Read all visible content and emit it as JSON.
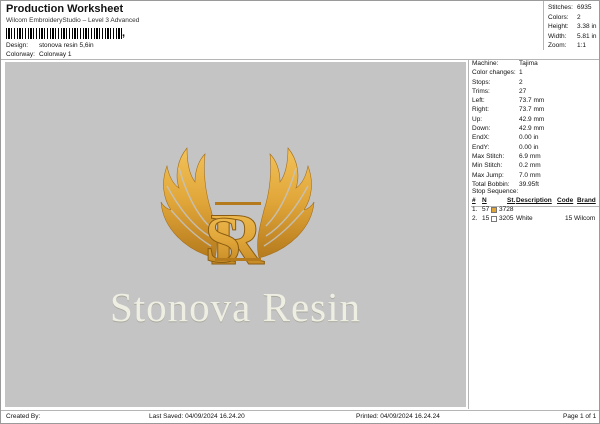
{
  "header": {
    "title": "Production Worksheet",
    "subtitle": "Wilcom EmbroideryStudio – Level 3 Advanced",
    "barcode_suffix": ",",
    "design_label": "Design:",
    "design_value": "stonova resin 5,6in",
    "colorway_label": "Colorway:",
    "colorway_value": "Colorway 1"
  },
  "top_stats": [
    {
      "label": "Stitches:",
      "value": "6935"
    },
    {
      "label": "Colors:",
      "value": "2"
    },
    {
      "label": "Height:",
      "value": "3.38 in"
    },
    {
      "label": "Width:",
      "value": "5.81 in"
    },
    {
      "label": "Zoom:",
      "value": "1:1"
    }
  ],
  "design": {
    "text": "Stonova Resin",
    "gold": "#e0a538",
    "gold_dark": "#b57a1c",
    "text_color": "#eeeee3",
    "background": "#c4c4c4"
  },
  "machine_info": [
    {
      "label": "Machine:",
      "value": "Tajima"
    },
    {
      "label": "Color changes:",
      "value": "1"
    },
    {
      "label": "Stops:",
      "value": "2"
    },
    {
      "label": "Trims:",
      "value": "27"
    },
    {
      "label": "Left:",
      "value": "73.7 mm"
    },
    {
      "label": "Right:",
      "value": "73.7 mm"
    },
    {
      "label": "Up:",
      "value": "42.9 mm"
    },
    {
      "label": "Down:",
      "value": "42.9 mm"
    },
    {
      "label": "EndX:",
      "value": "0.00 in"
    },
    {
      "label": "EndY:",
      "value": "0.00 in"
    },
    {
      "label": "Max Stitch:",
      "value": "6.9 mm"
    },
    {
      "label": "Min Stitch:",
      "value": "0.2 mm"
    },
    {
      "label": "Max Jump:",
      "value": "7.0 mm"
    },
    {
      "label": "Total Bobbin:",
      "value": "39.95ft"
    }
  ],
  "stop_sequence": {
    "title": "Stop Sequence:",
    "columns": [
      "#",
      "N",
      "St.",
      "Description",
      "Code",
      "Brand"
    ],
    "rows": [
      {
        "num": "1.",
        "n": "57",
        "color": "#e0a538",
        "st": "3728",
        "description": "",
        "code": "",
        "brand": ""
      },
      {
        "num": "2.",
        "n": "15",
        "color": "#ffffff",
        "st": "3205",
        "description": "White",
        "code": "15",
        "brand": "Wilcom"
      }
    ]
  },
  "footer": {
    "created_by": "Created By:",
    "last_saved": "Last Saved: 04/09/2024 16.24.20",
    "printed": "Printed: 04/09/2024 16.24.24",
    "page": "Page 1 of 1"
  }
}
